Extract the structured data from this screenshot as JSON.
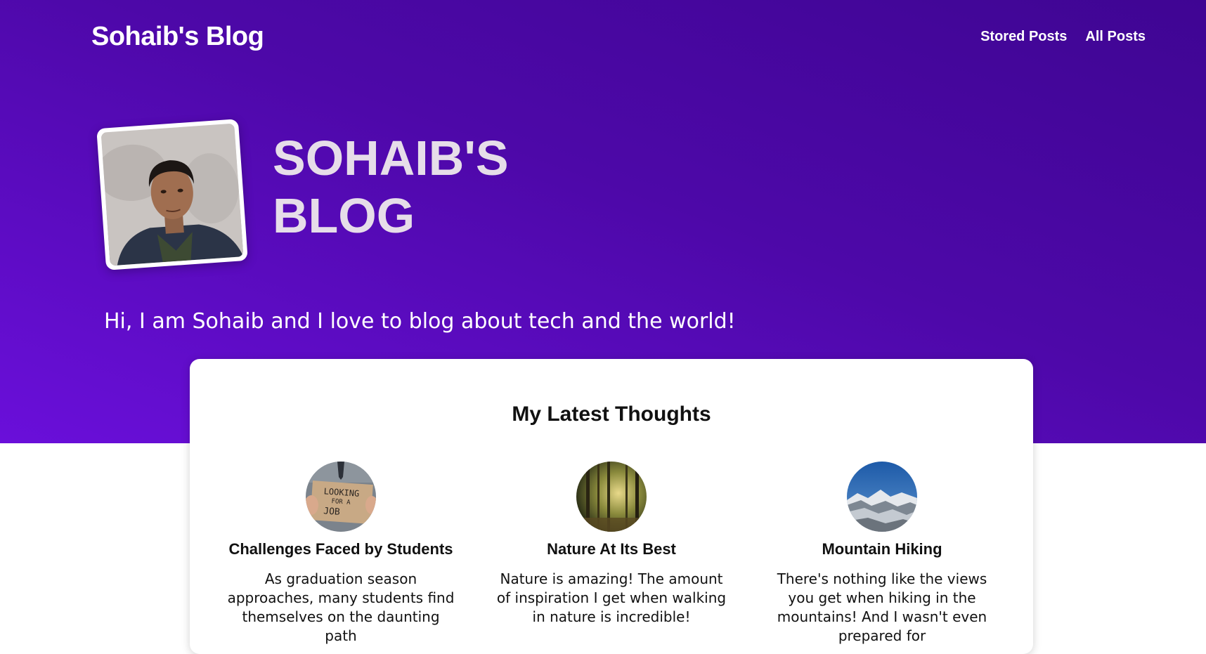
{
  "header": {
    "logo": "Sohaib's Blog",
    "nav": [
      {
        "label": "Stored Posts"
      },
      {
        "label": "All Posts"
      }
    ]
  },
  "hero": {
    "title": "Sohaib's Blog",
    "tagline": "Hi, I am Sohaib and I love to blog about tech and the world!"
  },
  "latest": {
    "title": "My Latest Thoughts",
    "posts": [
      {
        "title": "Challenges Faced by Students",
        "excerpt": "As graduation season approaches, many students find themselves on the daunting path",
        "image": "job-search-sign-image"
      },
      {
        "title": "Nature At Its Best",
        "excerpt": "Nature is amazing! The amount of inspiration I get when walking in nature is incredible!",
        "image": "forest-image"
      },
      {
        "title": "Mountain Hiking",
        "excerpt": "There's nothing like the views you get when hiking in the mountains! And I wasn't even prepared for",
        "image": "mountain-image"
      }
    ]
  },
  "colors": {
    "hero_top": "#3f0593",
    "hero_bottom": "#6a0fda",
    "hero_title": "#e6dde9",
    "card_bg": "#ffffff"
  }
}
